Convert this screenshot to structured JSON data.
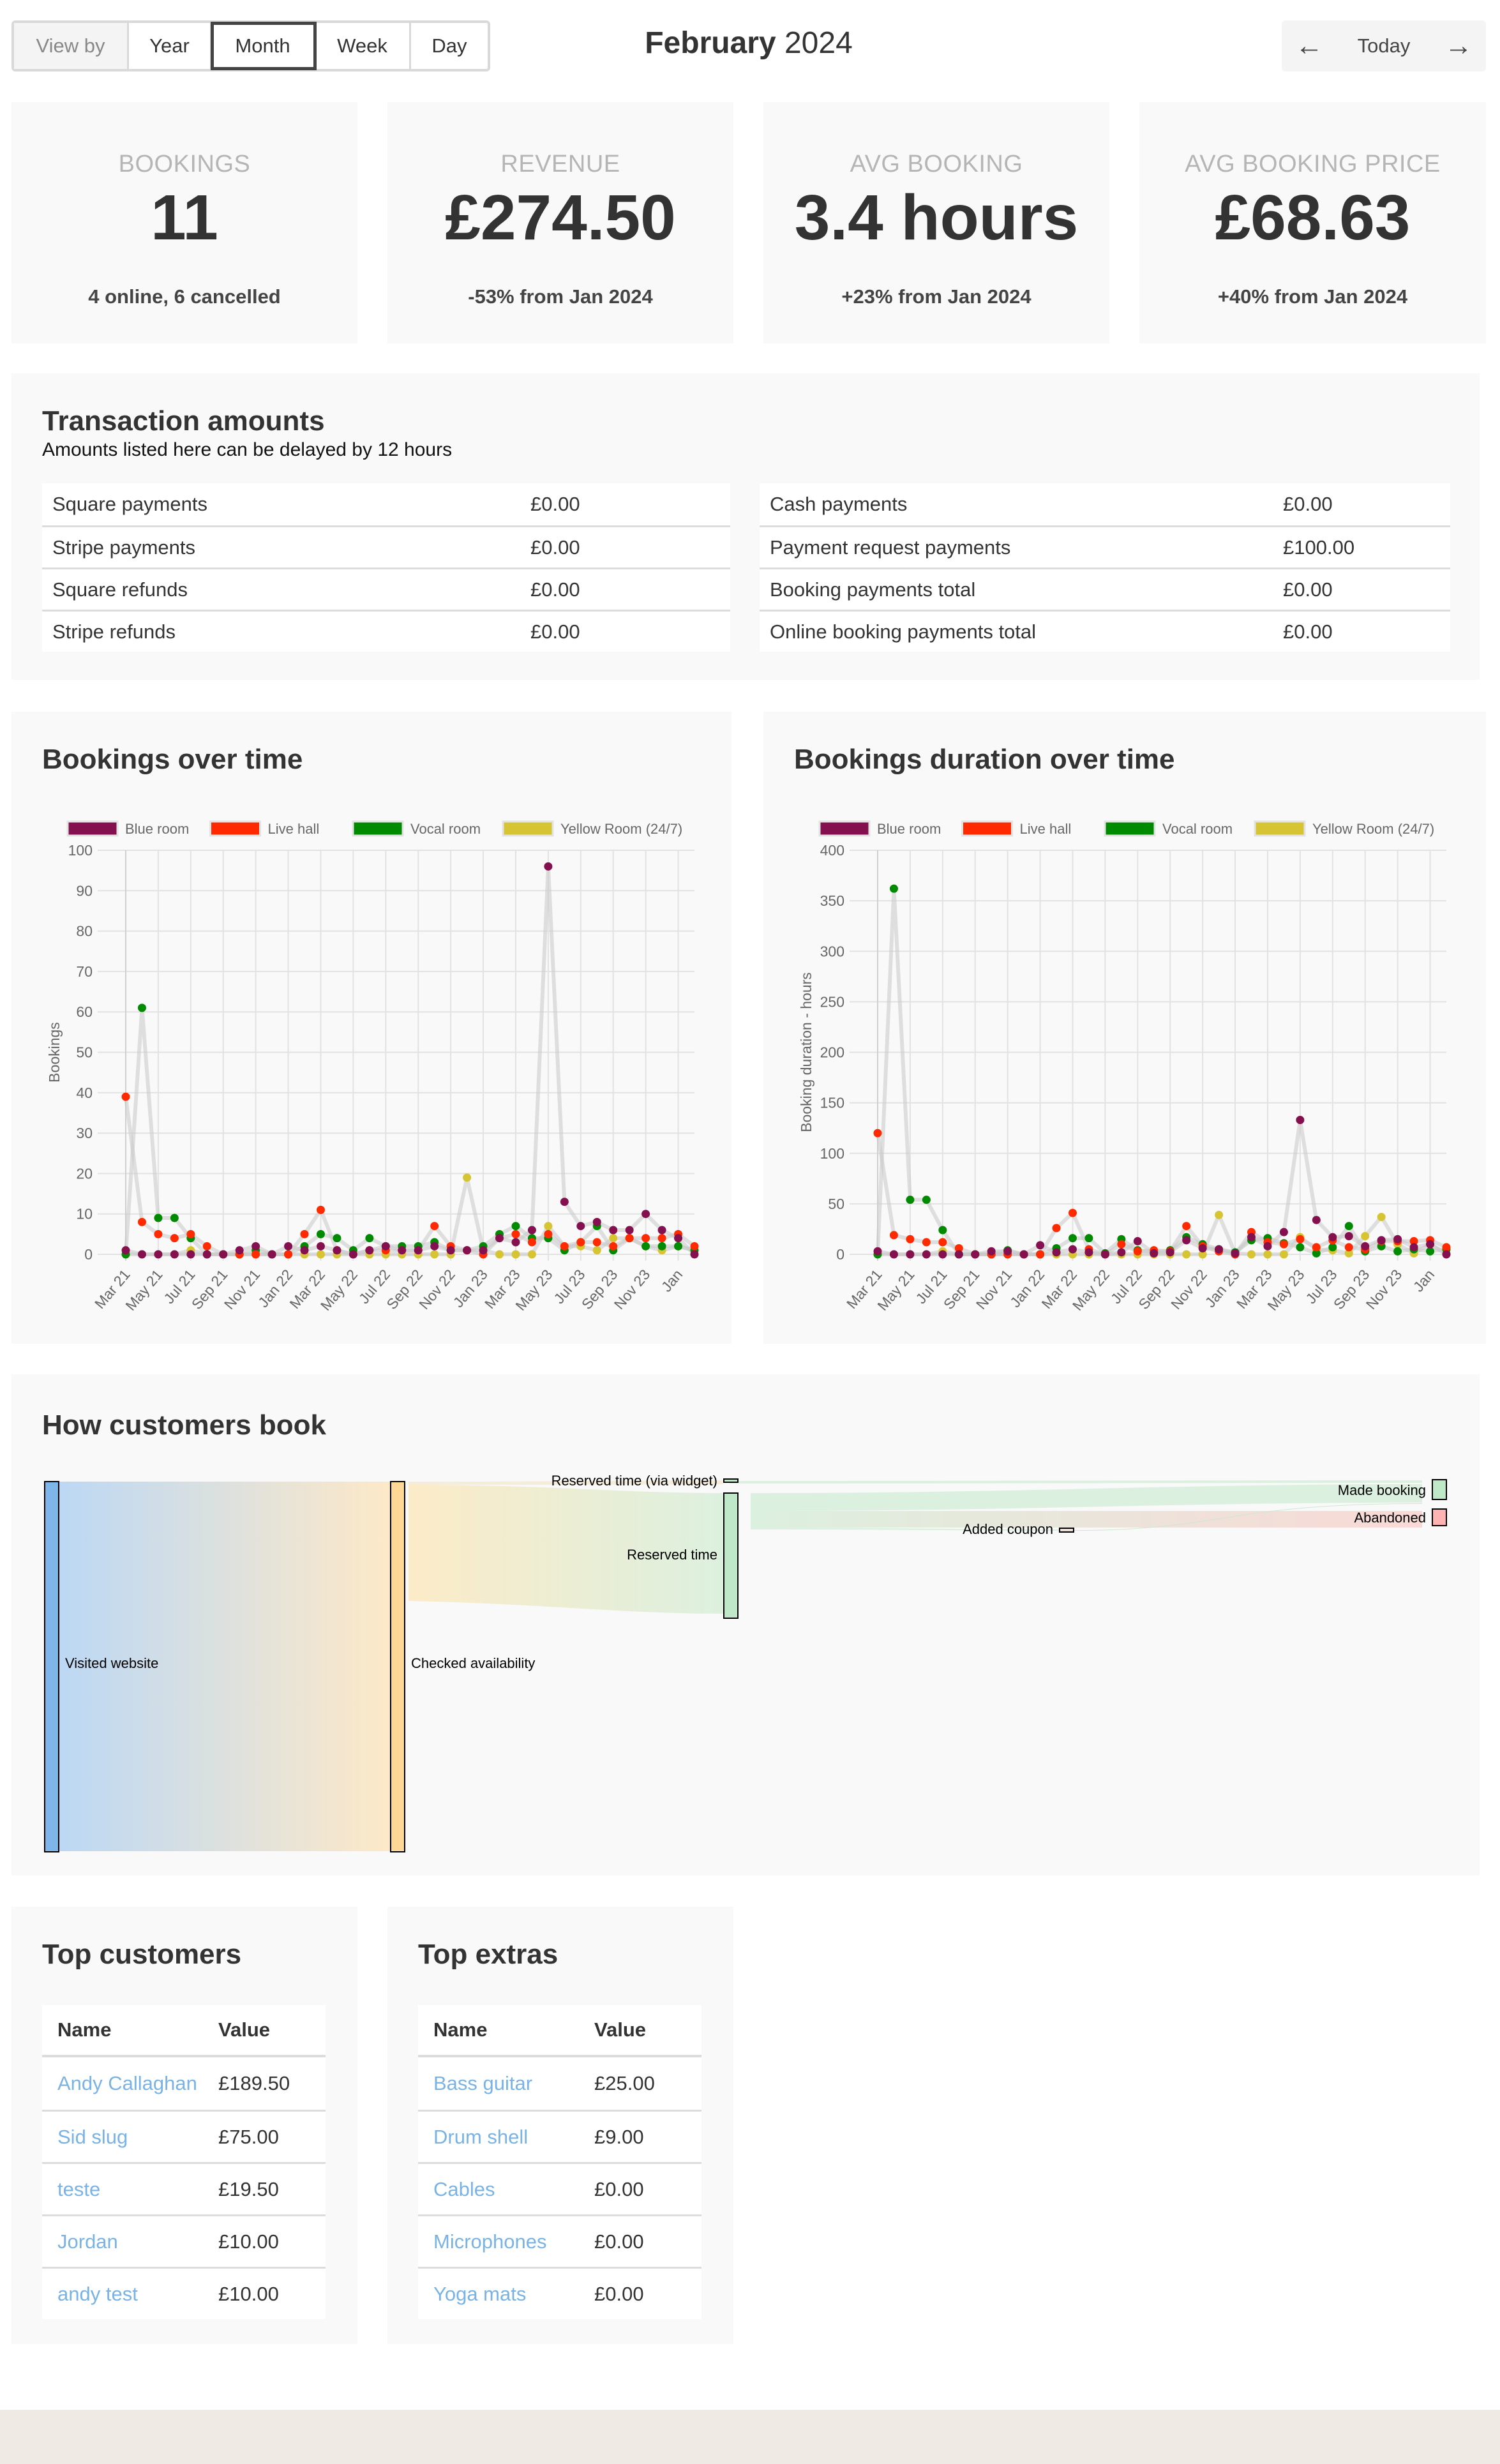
{
  "toolbar": {
    "view_by_label": "View by",
    "views": [
      "Year",
      "Month",
      "Week",
      "Day"
    ],
    "active_view": "Month",
    "period_month": "February",
    "period_year": "2024",
    "today_label": "Today",
    "prev_icon": "arrow-left-icon",
    "next_icon": "arrow-right-icon"
  },
  "stats": [
    {
      "label": "BOOKINGS",
      "value": "11",
      "sub": "4 online, 6 cancelled"
    },
    {
      "label": "REVENUE",
      "value": "£274.50",
      "sub": "-53% from Jan 2024"
    },
    {
      "label": "AVG BOOKING",
      "value": "3.4 hours",
      "sub": "+23% from Jan 2024"
    },
    {
      "label": "AVG BOOKING PRICE",
      "value": "£68.63",
      "sub": "+40% from Jan 2024"
    }
  ],
  "transactions": {
    "title": "Transaction amounts",
    "note": "Amounts listed here can be delayed by 12 hours",
    "left": [
      {
        "label": "Square payments",
        "value": "£0.00"
      },
      {
        "label": "Stripe payments",
        "value": "£0.00"
      },
      {
        "label": "Square refunds",
        "value": "£0.00"
      },
      {
        "label": "Stripe refunds",
        "value": "£0.00"
      }
    ],
    "right": [
      {
        "label": "Cash payments",
        "value": "£0.00"
      },
      {
        "label": "Payment request payments",
        "value": "£100.00"
      },
      {
        "label": "Booking payments total",
        "value": "£0.00"
      },
      {
        "label": "Online booking payments total",
        "value": "£0.00"
      }
    ]
  },
  "chart_data": [
    {
      "type": "line",
      "title": "Bookings over time",
      "xlabel": "",
      "ylabel": "Bookings",
      "ylim": [
        0,
        100
      ],
      "yticks": [
        0,
        10,
        20,
        30,
        40,
        50,
        60,
        70,
        80,
        90,
        100
      ],
      "grid": true,
      "legend": "top-left",
      "x": [
        "Mar 21",
        "Apr 21",
        "May 21",
        "Jun 21",
        "Jul 21",
        "Aug 21",
        "Sep 21",
        "Oct 21",
        "Nov 21",
        "Dec 21",
        "Jan 22",
        "Feb 22",
        "Mar 22",
        "Apr 22",
        "May 22",
        "Jun 22",
        "Jul 22",
        "Aug 22",
        "Sep 22",
        "Oct 22",
        "Nov 22",
        "Dec 22",
        "Jan 23",
        "Feb 23",
        "Mar 23",
        "Apr 23",
        "May 23",
        "Jun 23",
        "Jul 23",
        "Aug 23",
        "Sep 23",
        "Oct 23",
        "Nov 23",
        "Dec 23",
        "Jan",
        "Feb"
      ],
      "xtick_labels": [
        "Mar 21",
        "May 21",
        "Jul 21",
        "Sep 21",
        "Nov 21",
        "Jan 22",
        "Mar 22",
        "May 22",
        "Jul 22",
        "Sep 22",
        "Nov 22",
        "Jan 23",
        "Mar 23",
        "May 23",
        "Jul 23",
        "Sep 23",
        "Nov 23",
        "Jan"
      ],
      "series": [
        {
          "name": "Blue room",
          "color": "#84104f",
          "values": [
            1,
            0,
            0,
            0,
            0,
            0,
            0,
            1,
            2,
            0,
            2,
            1,
            2,
            1,
            0,
            1,
            2,
            1,
            1,
            2,
            1,
            1,
            1,
            4,
            3,
            6,
            96,
            13,
            7,
            8,
            6,
            6,
            10,
            6,
            4,
            0
          ]
        },
        {
          "name": "Live hall",
          "color": "#ff2a00",
          "values": [
            39,
            8,
            5,
            4,
            5,
            2,
            0,
            0,
            0,
            0,
            0,
            5,
            11,
            1,
            0,
            1,
            1,
            1,
            1,
            7,
            2,
            1,
            0,
            4,
            5,
            3,
            5,
            2,
            3,
            3,
            2,
            4,
            4,
            4,
            5,
            2
          ]
        },
        {
          "name": "Vocal room",
          "color": "#008a00",
          "values": [
            0,
            61,
            9,
            9,
            4,
            0,
            0,
            0,
            1,
            0,
            0,
            2,
            5,
            4,
            1,
            4,
            2,
            2,
            2,
            3,
            1,
            1,
            2,
            5,
            7,
            4,
            4,
            1,
            3,
            7,
            1,
            4,
            2,
            2,
            2,
            1
          ]
        },
        {
          "name": "Yellow Room (24/7)",
          "color": "#d6c433",
          "values": [
            0,
            0,
            0,
            0,
            1,
            0,
            0,
            0,
            0,
            0,
            0,
            0,
            0,
            0,
            0,
            0,
            0,
            0,
            0,
            0,
            0,
            19,
            1,
            0,
            0,
            0,
            7,
            2,
            2,
            1,
            4,
            4,
            2,
            1,
            2,
            1
          ]
        }
      ]
    },
    {
      "type": "line",
      "title": "Bookings duration over time",
      "xlabel": "",
      "ylabel": "Booking duration - hours",
      "ylim": [
        0,
        400
      ],
      "yticks": [
        0,
        50,
        100,
        150,
        200,
        250,
        300,
        350,
        400
      ],
      "grid": true,
      "legend": "top-left",
      "x": [
        "Mar 21",
        "Apr 21",
        "May 21",
        "Jun 21",
        "Jul 21",
        "Aug 21",
        "Sep 21",
        "Oct 21",
        "Nov 21",
        "Dec 21",
        "Jan 22",
        "Feb 22",
        "Mar 22",
        "Apr 22",
        "May 22",
        "Jun 22",
        "Jul 22",
        "Aug 22",
        "Sep 22",
        "Oct 22",
        "Nov 22",
        "Dec 22",
        "Jan 23",
        "Feb 23",
        "Mar 23",
        "Apr 23",
        "May 23",
        "Jun 23",
        "Jul 23",
        "Aug 23",
        "Sep 23",
        "Oct 23",
        "Nov 23",
        "Dec 23",
        "Jan",
        "Feb"
      ],
      "xtick_labels": [
        "Mar 21",
        "May 21",
        "Jul 21",
        "Sep 21",
        "Nov 21",
        "Jan 22",
        "Mar 22",
        "May 22",
        "Jul 22",
        "Sep 22",
        "Nov 22",
        "Jan 23",
        "Mar 23",
        "May 23",
        "Jul 23",
        "Sep 23",
        "Nov 23",
        "Jan"
      ],
      "series": [
        {
          "name": "Blue room",
          "color": "#84104f",
          "values": [
            3,
            0,
            0,
            0,
            0,
            0,
            0,
            3,
            3,
            0,
            9,
            2,
            5,
            2,
            0,
            2,
            13,
            1,
            2,
            14,
            6,
            5,
            1,
            17,
            8,
            22,
            133,
            34,
            17,
            18,
            8,
            14,
            15,
            7,
            10,
            0
          ]
        },
        {
          "name": "Live hall",
          "color": "#ff2a00",
          "values": [
            120,
            19,
            15,
            12,
            12,
            6,
            0,
            0,
            0,
            0,
            0,
            26,
            41,
            5,
            0,
            10,
            3,
            4,
            3,
            28,
            8,
            3,
            0,
            22,
            12,
            10,
            15,
            7,
            14,
            7,
            5,
            13,
            13,
            13,
            14,
            7
          ]
        },
        {
          "name": "Vocal room",
          "color": "#008a00",
          "values": [
            0,
            362,
            54,
            54,
            24,
            0,
            0,
            0,
            4,
            0,
            0,
            6,
            16,
            16,
            1,
            15,
            4,
            2,
            4,
            17,
            10,
            5,
            2,
            14,
            16,
            11,
            7,
            1,
            7,
            28,
            3,
            8,
            3,
            5,
            3,
            5
          ]
        },
        {
          "name": "Yellow Room (24/7)",
          "color": "#d6c433",
          "values": [
            0,
            0,
            0,
            0,
            3,
            0,
            0,
            0,
            0,
            0,
            0,
            0,
            0,
            0,
            0,
            0,
            0,
            0,
            0,
            0,
            0,
            39,
            1,
            0,
            0,
            0,
            17,
            5,
            4,
            1,
            18,
            37,
            10,
            1,
            10,
            1
          ]
        }
      ]
    }
  ],
  "sankey": {
    "title": "How customers book",
    "nodes": [
      {
        "label": "Visited website",
        "color": "#7fb6ea"
      },
      {
        "label": "Checked availability",
        "color": "#ffd896"
      },
      {
        "label": "Reserved time (via widget)",
        "color": "#bfe8c8"
      },
      {
        "label": "Reserved time",
        "color": "#bfe8c8"
      },
      {
        "label": "Added coupon",
        "color": "#ebe0d8"
      },
      {
        "label": "Made booking",
        "color": "#bfe8c8"
      },
      {
        "label": "Abandoned",
        "color": "#ffb3b3"
      }
    ]
  },
  "top_customers": {
    "title": "Top customers",
    "headers": [
      "Name",
      "Value"
    ],
    "rows": [
      {
        "name": "Andy Callaghan",
        "value": "£189.50"
      },
      {
        "name": "Sid slug",
        "value": "£75.00"
      },
      {
        "name": "teste",
        "value": "£19.50"
      },
      {
        "name": "Jordan",
        "value": "£10.00"
      },
      {
        "name": "andy test",
        "value": "£10.00"
      }
    ]
  },
  "top_extras": {
    "title": "Top extras",
    "headers": [
      "Name",
      "Value"
    ],
    "rows": [
      {
        "name": "Bass guitar",
        "value": "£25.00"
      },
      {
        "name": "Drum shell",
        "value": "£9.00"
      },
      {
        "name": "Cables",
        "value": "£0.00"
      },
      {
        "name": "Microphones",
        "value": "£0.00"
      },
      {
        "name": "Yoga mats",
        "value": "£0.00"
      }
    ]
  }
}
